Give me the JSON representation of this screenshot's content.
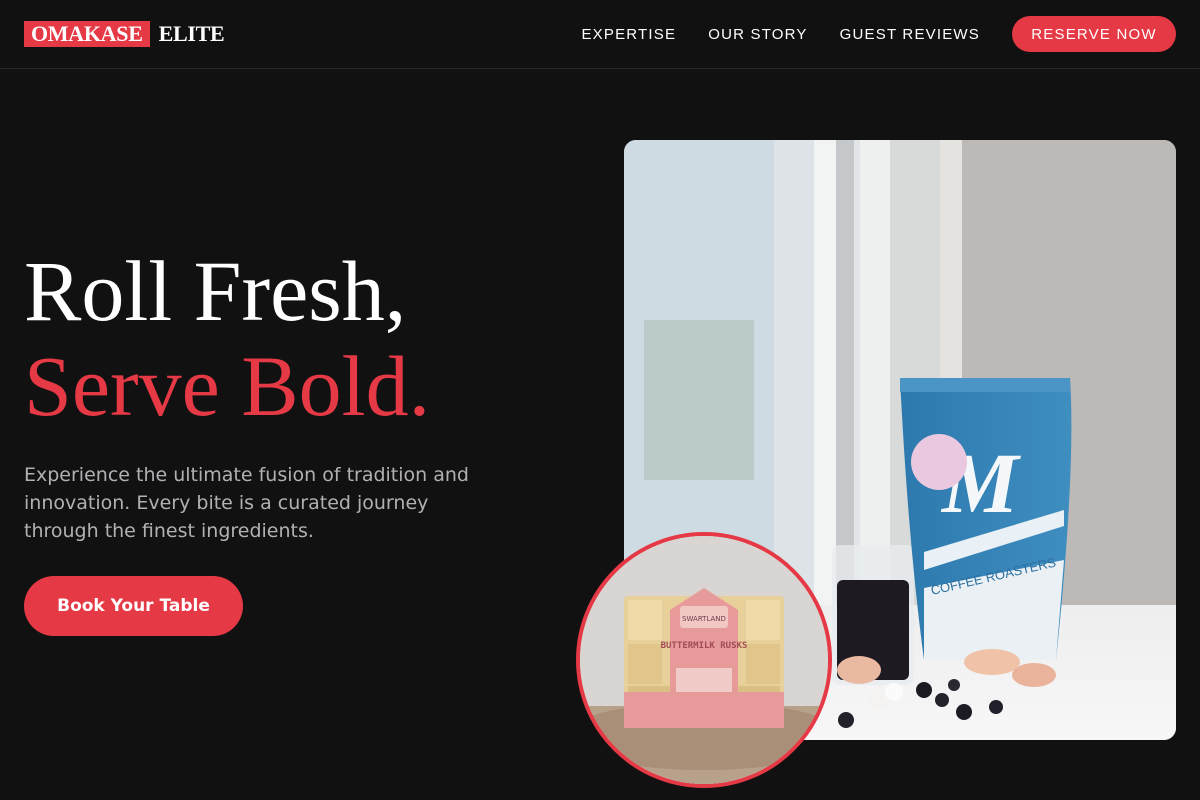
{
  "brand": {
    "name_highlight": "OMAKASE",
    "name_rest": "ELITE",
    "accent_color": "#e53945",
    "background_color": "#121112"
  },
  "nav": {
    "links": [
      "EXPERTISE",
      "OUR STORY",
      "GUEST REVIEWS"
    ],
    "cta_label": "RESERVE NOW"
  },
  "hero": {
    "title_line1": "Roll Fresh,",
    "title_line2": "Serve Bold.",
    "description": "Experience the ultimate fusion of tradition and innovation. Every bite is a curated journey through the finest ingredients.",
    "button_label": "Book Your Table"
  },
  "images": {
    "main": {
      "bag_label": "COFFEE ROASTERS",
      "bag_logo": "M"
    },
    "inset": {
      "box_brand": "SWARTLAND",
      "box_product": "BUTTERMILK RUSKS"
    }
  }
}
